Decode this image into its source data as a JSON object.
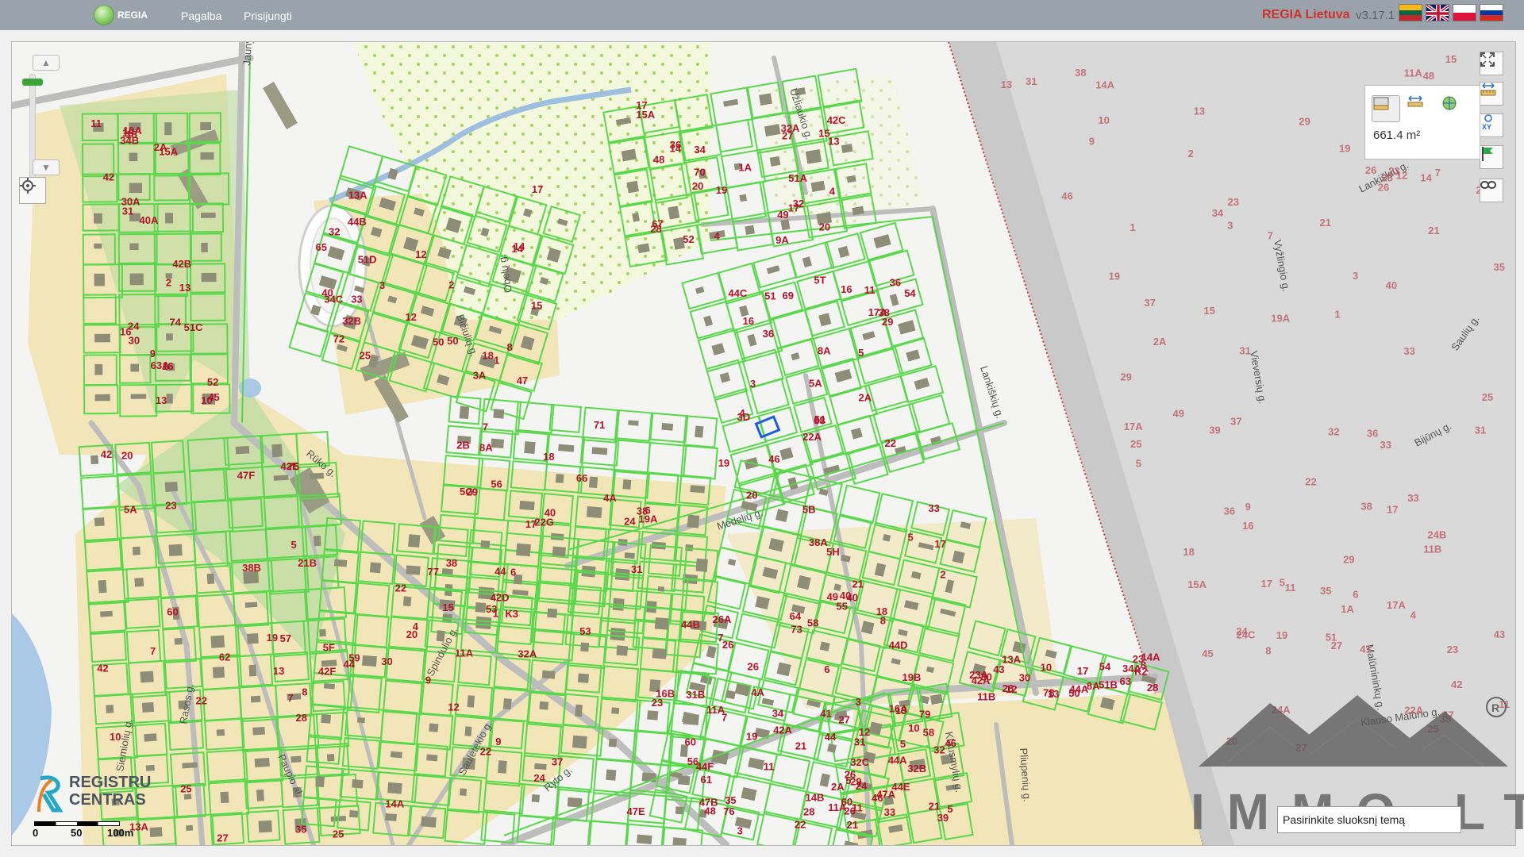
{
  "header": {
    "logo_text": "REGIA",
    "nav": [
      {
        "label": "Pagalba"
      },
      {
        "label": "Prisijungti"
      }
    ],
    "brand": "REGIA Lietuva",
    "version": "v3.17.1",
    "languages": [
      "lt",
      "en",
      "pl",
      "ru"
    ]
  },
  "toolbar": {
    "measure_value": "661.4 m²"
  },
  "scale": {
    "labels": [
      "0",
      "50",
      "100m"
    ]
  },
  "registru_logo": "REGISTRU CENTRAS",
  "watermark": "IMMO.LT",
  "layer_input": {
    "value": "Pasirinkite sluoksnį temą"
  },
  "streets": [
    "Jaunystės g.",
    "Užliaukio g.",
    "Obelų g.",
    "Bičiulių g.",
    "Rūko g.",
    "Medelių g.",
    "Lankiškių g.",
    "Spindulio g.",
    "Saulėtekio g.",
    "Ryto g.",
    "Paupio al.",
    "Rasos g.",
    "Siemiolių g.",
    "Klausmylių g.",
    "Pliupenių g.",
    "Vyžlingio g.",
    "Vieversių g.",
    "Bijūnų g.",
    "Saulių g.",
    "Lankiškių g.",
    "Klauso Malūno g.",
    "Malūnininkų g."
  ],
  "parcel_labels": [
    "2A",
    "2",
    "28",
    "4",
    "1",
    "4A",
    "13A",
    "11A",
    "13",
    "12",
    "10",
    "9",
    "8",
    "9A",
    "8A",
    "7",
    "6",
    "5",
    "4",
    "3",
    "2A",
    "13",
    "11",
    "1",
    "17",
    "5T",
    "5G",
    "5H",
    "7",
    "5F",
    "5",
    "3",
    "8",
    "10",
    "12",
    "14",
    "16",
    "18",
    "20",
    "22",
    "24",
    "26",
    "28",
    "30",
    "30A",
    "3A",
    "4",
    "3",
    "6",
    "8",
    "10",
    "12",
    "5",
    "7",
    "8A",
    "10A",
    "13A",
    "15A",
    "17A",
    "15",
    "17",
    "13",
    "14A",
    "5",
    "21",
    "23A",
    "16",
    "18",
    "20",
    "22A",
    "22G",
    "26A",
    "25",
    "23",
    "21",
    "19",
    "17",
    "16",
    "14",
    "13",
    "11",
    "29",
    "26",
    "27",
    "22",
    "33",
    "35",
    "28",
    "15",
    "12",
    "32",
    "3D",
    "8A",
    "5B",
    "5A",
    "16B",
    "16A",
    "14B",
    "14A",
    "16",
    "32B",
    "32A",
    "36",
    "38",
    "38A",
    "38B",
    "44B",
    "44A",
    "44",
    "42A",
    "42",
    "40",
    "20",
    "22",
    "24",
    "26",
    "28",
    "30",
    "32",
    "34",
    "51B",
    "51C",
    "51D",
    "51A",
    "51",
    "53",
    "49",
    "47F",
    "47E",
    "47A",
    "47B",
    "1",
    "2",
    "3",
    "4",
    "5",
    "6",
    "7",
    "8",
    "9",
    "10",
    "11",
    "12",
    "13",
    "14",
    "15",
    "16",
    "17",
    "18",
    "19",
    "20",
    "21",
    "22",
    "23",
    "24",
    "25",
    "27",
    "29",
    "31",
    "33",
    "35",
    "37",
    "39",
    "41",
    "43",
    "45",
    "47",
    "49",
    "51",
    "53",
    "55",
    "57",
    "59",
    "60",
    "61",
    "63",
    "63A",
    "65",
    "67",
    "69",
    "71",
    "73",
    "75",
    "77",
    "79",
    "76",
    "78",
    "74",
    "72",
    "70",
    "68",
    "66",
    "64",
    "62",
    "60",
    "58",
    "56",
    "54",
    "52",
    "50",
    "48",
    "46",
    "K3",
    "40",
    "42",
    "44",
    "46",
    "42A",
    "44A",
    "42B",
    "44B",
    "42C",
    "44C",
    "42D",
    "44D",
    "42E",
    "42F",
    "44E",
    "44F",
    "K2",
    "40A",
    "50",
    "52",
    "54",
    "56",
    "58",
    "60",
    "32A",
    "32B",
    "32C",
    "34A",
    "34B",
    "34C",
    "1A",
    "2A",
    "2B",
    "5",
    "7",
    "9",
    "11",
    "11A",
    "11B",
    "13",
    "15",
    "17",
    "19",
    "19A",
    "21",
    "23",
    "25",
    "27",
    "29",
    "30",
    "31",
    "33",
    "36",
    "38",
    "40",
    "19B",
    "21B",
    "31B",
    "31",
    "11A",
    "13A",
    "15A",
    "17",
    "19",
    "5A",
    "4A",
    "2",
    "20",
    "22",
    "24",
    "26",
    "28",
    "30",
    "32",
    "34",
    "36",
    "38",
    "40",
    "42",
    "44",
    "46",
    "48",
    "50"
  ],
  "faded_labels": [
    "24A",
    "24B",
    "24C",
    "17A",
    "19",
    "21",
    "23",
    "25",
    "27",
    "29",
    "31",
    "33",
    "35",
    "32",
    "34",
    "36",
    "38",
    "40",
    "42",
    "44",
    "46",
    "48",
    "26",
    "28",
    "1",
    "3",
    "5",
    "7",
    "9",
    "11",
    "11A",
    "11B",
    "13",
    "15",
    "15A",
    "17",
    "17A",
    "19",
    "21",
    "22A",
    "23",
    "24",
    "25",
    "26",
    "27",
    "29",
    "31",
    "33",
    "35",
    "36",
    "37",
    "38",
    "39",
    "41",
    "43",
    "45",
    "47",
    "49",
    "51",
    "2",
    "2A",
    "4",
    "6",
    "8",
    "10",
    "12",
    "14",
    "14A",
    "16",
    "18",
    "20",
    "22",
    "1A",
    "1",
    "3",
    "5",
    "7",
    "9",
    "11",
    "13",
    "15",
    "17",
    "19",
    "19A",
    "21",
    "23",
    "25",
    "27",
    "29",
    "31",
    "33",
    "35",
    "37"
  ]
}
